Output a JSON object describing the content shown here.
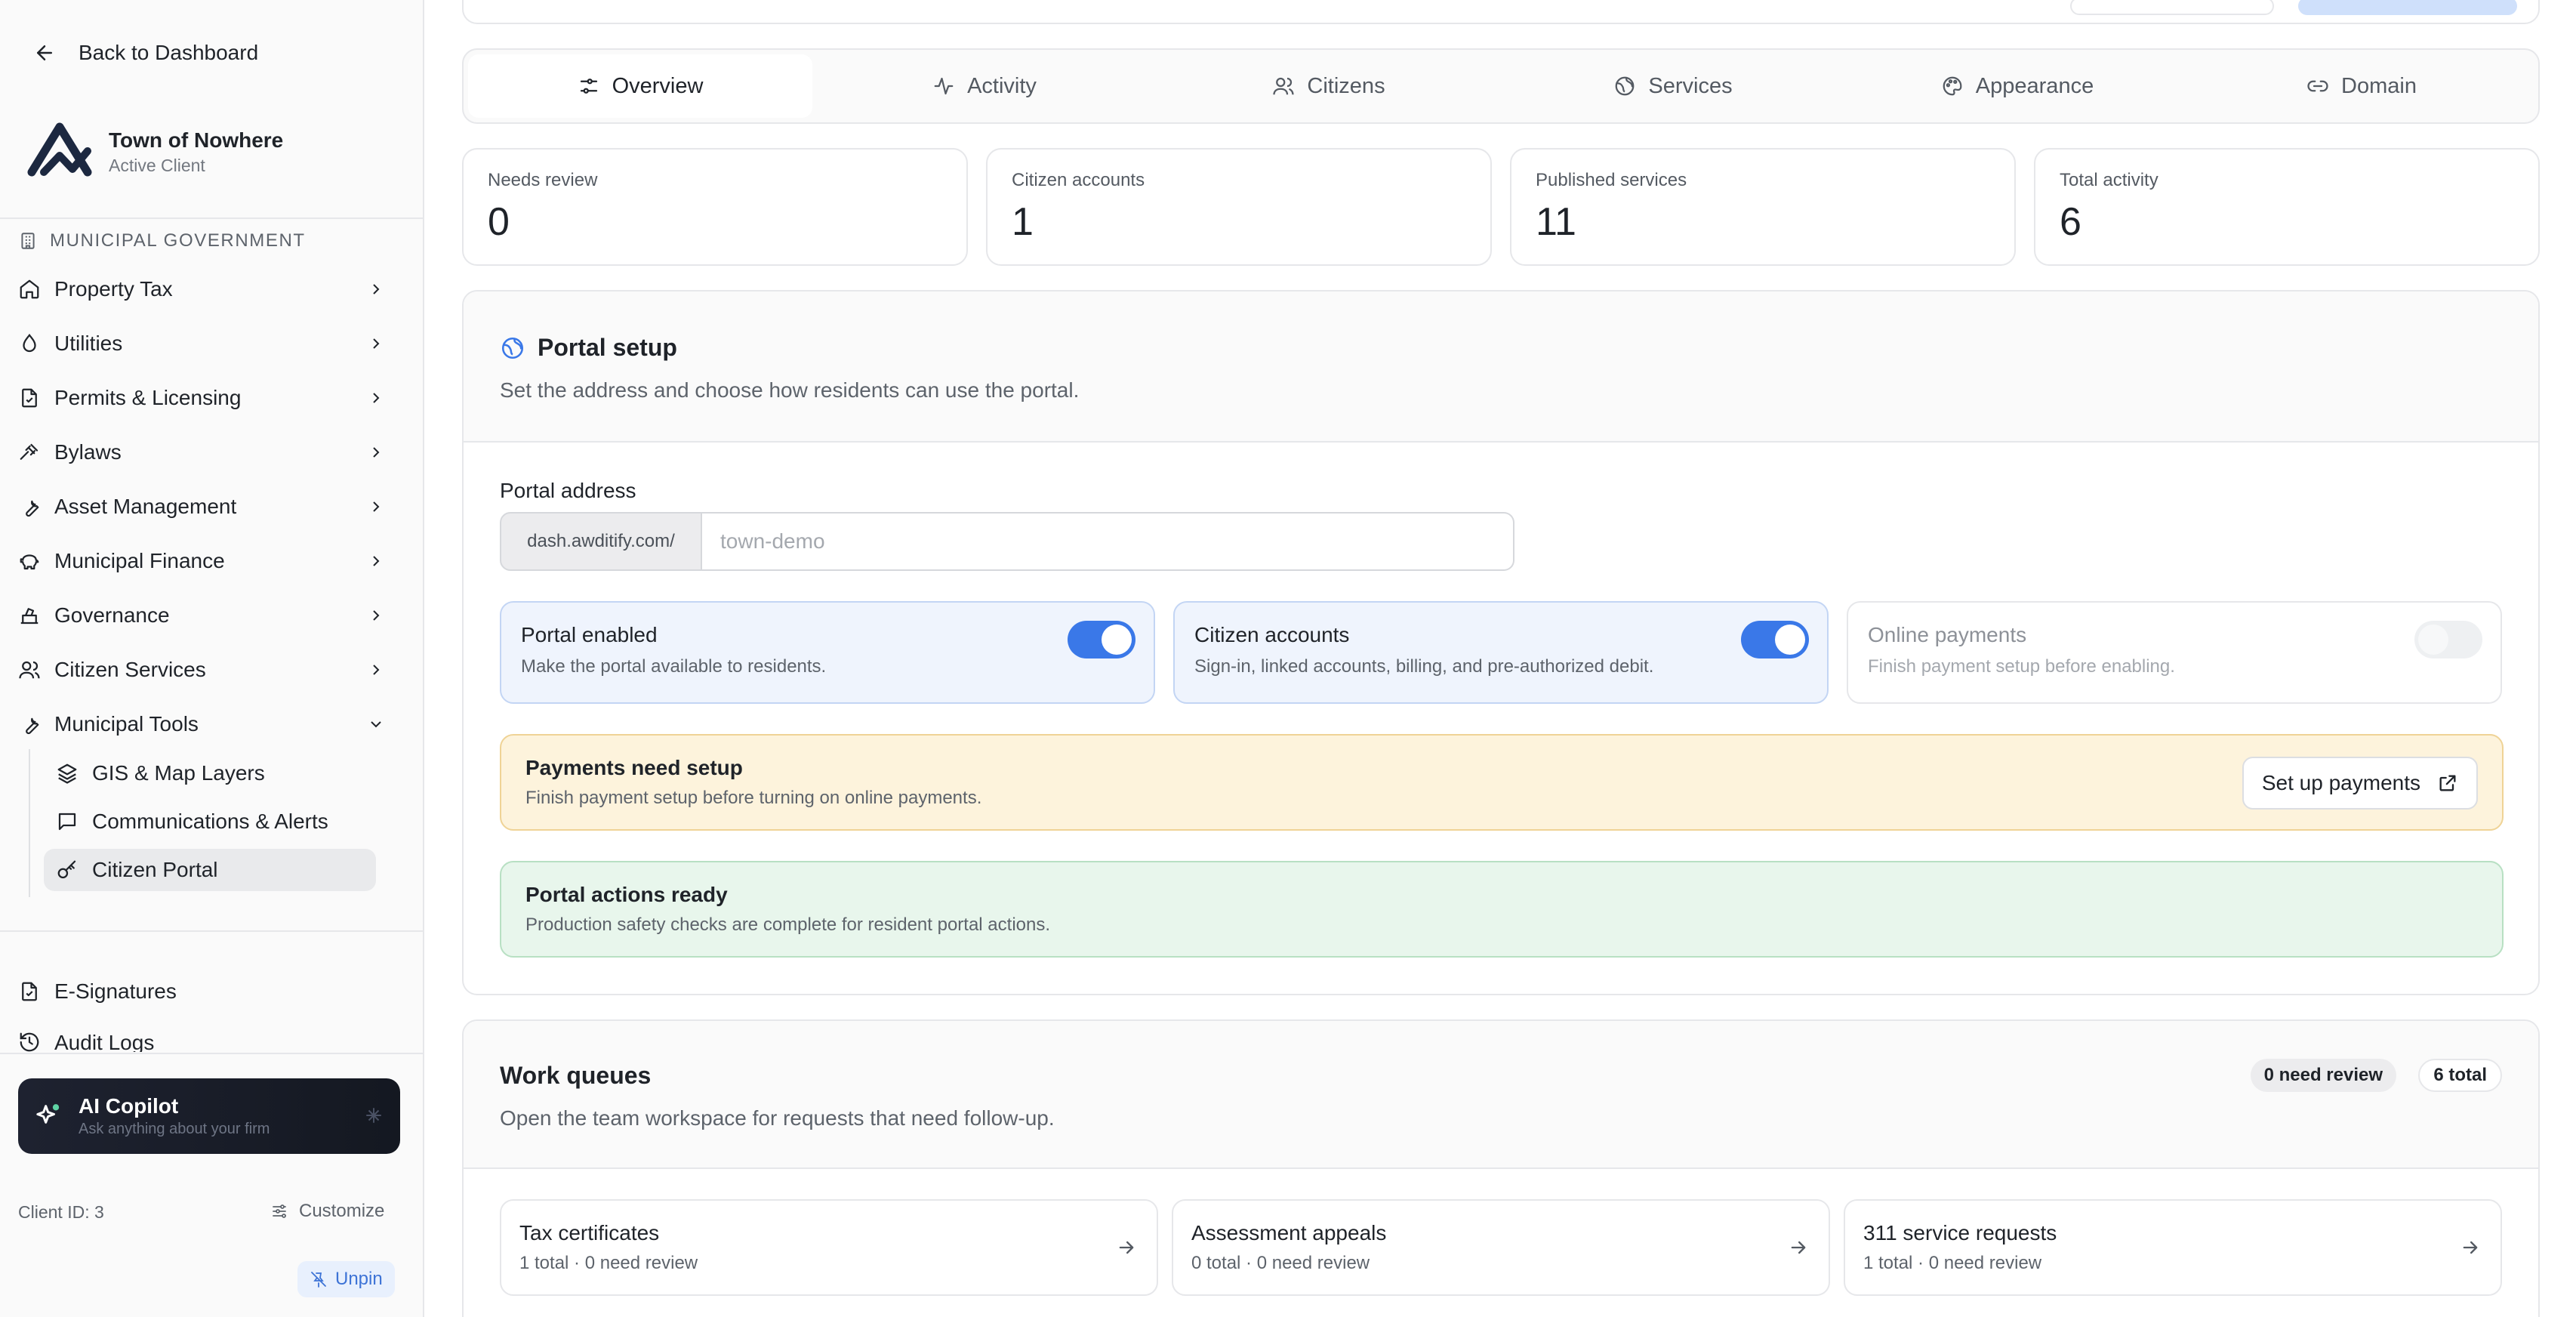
{
  "sidebar": {
    "back_label": "Back to Dashboard",
    "org_name": "Town of Nowhere",
    "org_status": "Active Client",
    "section_label": "MUNICIPAL GOVERNMENT",
    "items": [
      {
        "label": "Property Tax",
        "icon": "home-icon"
      },
      {
        "label": "Utilities",
        "icon": "droplet-icon"
      },
      {
        "label": "Permits & Licensing",
        "icon": "file-check-icon"
      },
      {
        "label": "Bylaws",
        "icon": "gavel-icon"
      },
      {
        "label": "Asset Management",
        "icon": "wrench-icon"
      },
      {
        "label": "Municipal Finance",
        "icon": "piggy-bank-icon"
      },
      {
        "label": "Governance",
        "icon": "ballot-box-icon"
      },
      {
        "label": "Citizen Services",
        "icon": "users-icon"
      },
      {
        "label": "Municipal Tools",
        "icon": "wrench-icon"
      }
    ],
    "sub_items": [
      {
        "label": "GIS & Map Layers",
        "icon": "layers-icon"
      },
      {
        "label": "Communications & Alerts",
        "icon": "message-square-icon"
      },
      {
        "label": "Citizen Portal",
        "icon": "key-icon",
        "active": true
      }
    ],
    "extra_items": [
      {
        "label": "E-Signatures",
        "icon": "file-signature-icon"
      },
      {
        "label": "Audit Logs",
        "icon": "history-icon"
      }
    ],
    "copilot_title": "AI Copilot",
    "copilot_subtitle": "Ask anything about your firm",
    "client_id": "Client ID: 3",
    "customize_label": "Customize",
    "unpin_label": "Unpin"
  },
  "tabs": [
    {
      "label": "Overview",
      "icon": "sliders-icon",
      "active": true
    },
    {
      "label": "Activity",
      "icon": "activity-icon"
    },
    {
      "label": "Citizens",
      "icon": "users-icon"
    },
    {
      "label": "Services",
      "icon": "globe-icon"
    },
    {
      "label": "Appearance",
      "icon": "palette-icon"
    },
    {
      "label": "Domain",
      "icon": "link-icon"
    }
  ],
  "stats": [
    {
      "label": "Needs review",
      "value": "0"
    },
    {
      "label": "Citizen accounts",
      "value": "1"
    },
    {
      "label": "Published services",
      "value": "11"
    },
    {
      "label": "Total activity",
      "value": "6"
    }
  ],
  "portal_setup": {
    "title": "Portal setup",
    "description": "Set the address and choose how residents can use the portal.",
    "address_label": "Portal address",
    "address_prefix": "dash.awditify.com/",
    "address_placeholder": "town-demo",
    "toggles": [
      {
        "title": "Portal enabled",
        "description": "Make the portal available to residents.",
        "on": true,
        "disabled": false
      },
      {
        "title": "Citizen accounts",
        "description": "Sign-in, linked accounts, billing, and pre-authorized debit.",
        "on": true,
        "disabled": false
      },
      {
        "title": "Online payments",
        "description": "Finish payment setup before enabling.",
        "on": false,
        "disabled": true
      }
    ],
    "payments_alert": {
      "title": "Payments need setup",
      "description": "Finish payment setup before turning on online payments.",
      "button_label": "Set up payments"
    },
    "ready_alert": {
      "title": "Portal actions ready",
      "description": "Production safety checks are complete for resident portal actions."
    }
  },
  "work_queues": {
    "title": "Work queues",
    "description": "Open the team workspace for requests that need follow-up.",
    "badge_review": "0 need review",
    "badge_total": "6 total",
    "queues": [
      {
        "title": "Tax certificates",
        "subtitle": "1 total · 0 need review"
      },
      {
        "title": "Assessment appeals",
        "subtitle": "0 total · 0 need review"
      },
      {
        "title": "311 service requests",
        "subtitle": "1 total · 0 need review"
      }
    ]
  },
  "colors": {
    "accent": "#3a78e8",
    "warning_bg": "#fdf3dc",
    "success_bg": "#e8f6ec",
    "copilot_bg": "#1e2230"
  }
}
